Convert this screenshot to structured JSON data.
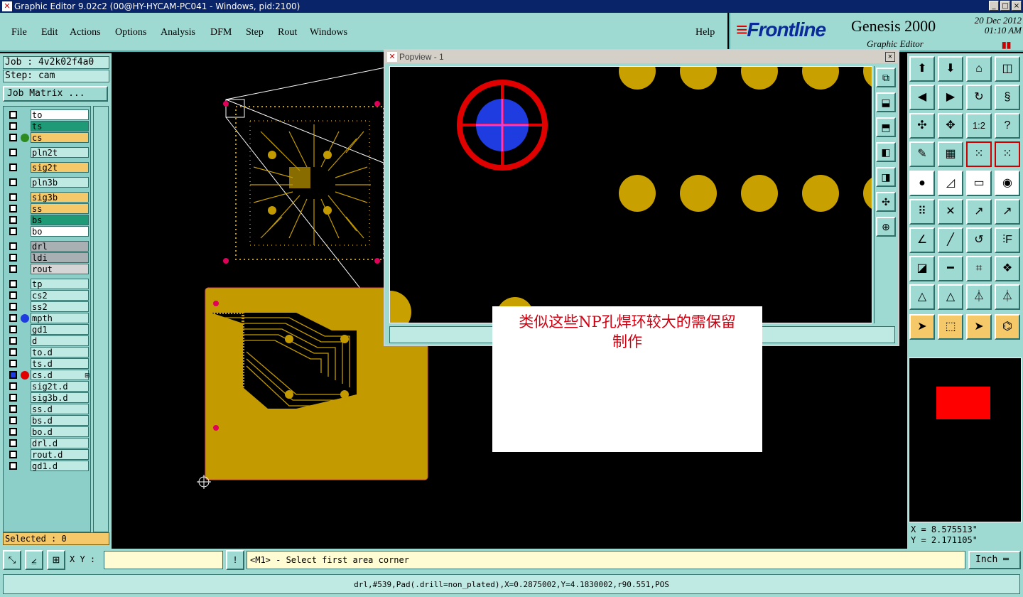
{
  "window": {
    "title": "Graphic Editor 9.02c2 (00@HY-HYCAM-PC041 - Windows, pid:2100)",
    "controls": [
      "_",
      "□",
      "×"
    ]
  },
  "menu": {
    "items": [
      "File",
      "Edit",
      "Actions",
      "Options",
      "Analysis",
      "DFM",
      "Step",
      "Rout",
      "Windows"
    ],
    "help": "Help"
  },
  "brand": {
    "logo": "Frontline",
    "product": "Genesis 2000",
    "subtitle": "Graphic Editor",
    "date": "20 Dec 2012",
    "time": "01:10 AM"
  },
  "job": {
    "job_label": "Job : 4v2k02f4a0",
    "step_label": "Step: cam",
    "matrix_button": "Job Matrix ..."
  },
  "layers": [
    {
      "name": "to",
      "bg": "#ffffff"
    },
    {
      "name": "ts",
      "bg": "#1f9a76"
    },
    {
      "name": "cs",
      "bg": "#f5c96a",
      "dot": "#2e8b20"
    },
    {
      "name": "pln2t",
      "bg": "#bfe9e3"
    },
    {
      "name": "sig2t",
      "bg": "#f5c96a"
    },
    {
      "name": "pln3b",
      "bg": "#bfe9e3"
    },
    {
      "name": "sig3b",
      "bg": "#f5c96a"
    },
    {
      "name": "ss",
      "bg": "#f5c96a"
    },
    {
      "name": "bs",
      "bg": "#1f9a76"
    },
    {
      "name": "bo",
      "bg": "#ffffff"
    },
    {
      "name": "drl",
      "bg": "#a9b0b3"
    },
    {
      "name": "ldi",
      "bg": "#a9b0b3"
    },
    {
      "name": "rout",
      "bg": "#d5d5d5"
    },
    {
      "name": "tp",
      "bg": "#bfe9e3"
    },
    {
      "name": "cs2",
      "bg": "#bfe9e3"
    },
    {
      "name": "ss2",
      "bg": "#bfe9e3"
    },
    {
      "name": "mpth",
      "bg": "#bfe9e3",
      "dot": "#1f3ce0"
    },
    {
      "name": "gd1",
      "bg": "#bfe9e3"
    },
    {
      "name": "d",
      "bg": "#bfe9e3"
    },
    {
      "name": "to.d",
      "bg": "#bfe9e3"
    },
    {
      "name": "ts.d",
      "bg": "#bfe9e3"
    },
    {
      "name": "cs.d",
      "bg": "#bfe9e3",
      "dot": "#e00000",
      "active": true
    },
    {
      "name": "sig2t.d",
      "bg": "#bfe9e3"
    },
    {
      "name": "sig3b.d",
      "bg": "#bfe9e3"
    },
    {
      "name": "ss.d",
      "bg": "#bfe9e3"
    },
    {
      "name": "bs.d",
      "bg": "#bfe9e3"
    },
    {
      "name": "bo.d",
      "bg": "#bfe9e3"
    },
    {
      "name": "drl.d",
      "bg": "#bfe9e3"
    },
    {
      "name": "rout.d",
      "bg": "#bfe9e3"
    },
    {
      "name": "gd1.d",
      "bg": "#bfe9e3"
    }
  ],
  "selected": "Selected : 0",
  "popview": {
    "title": "Popview - 1"
  },
  "annotation": {
    "line1": "类似这些NP孔焊环较大的需保留",
    "line2": "制作"
  },
  "coords": {
    "x": "X = 8.575513\"",
    "y": "Y = 2.171105\""
  },
  "bottom": {
    "xy_label": "X Y :",
    "xy_value": "",
    "message": "<M1> - Select first area corner",
    "unit": "Inch"
  },
  "status": "drl,#539,Pad(.drill=non_plated),X=0.2875002,Y=4.1830002,r90.551,POS",
  "colors": {
    "panel": "#9ed9d2",
    "copper": "#c39a00",
    "pad_yellow": "#c8a000",
    "drill_red": "#e00000",
    "drill_blue": "#1f3ce0",
    "annotation_text": "#d00010"
  },
  "tools": {
    "right_icons": [
      "home-icon",
      "down-arrow-icon",
      "house-icon",
      "window-icon",
      "left-box-icon",
      "right-box-icon",
      "rotate-icon",
      "mirror-icon",
      "zoom-fit-icon",
      "zoom-center-icon",
      "scale-1-2-icon",
      "help-icon",
      "measure-tool-icon",
      "grid-icon",
      "net-red-icon",
      "net-red-2-icon",
      "pad-add-icon",
      "line-draw-icon",
      "ruler-icon",
      "circle-icon",
      "node-blue-icon",
      "cross-node-icon",
      "connect-red-blue-icon",
      "blue-red-arrow-icon",
      "angle-icon",
      "line-icon",
      "arc-icon",
      "text-f-icon",
      "pad-red-icon",
      "line-red-icon",
      "dimension-icon",
      "blob-icon",
      "triangle-1-icon",
      "triangle-2-icon",
      "triangle-3-icon",
      "triangle-4-icon",
      "select-arrow-icon",
      "select-box-icon",
      "select-red-icon",
      "route-icon"
    ],
    "scale_label": "1:2"
  }
}
